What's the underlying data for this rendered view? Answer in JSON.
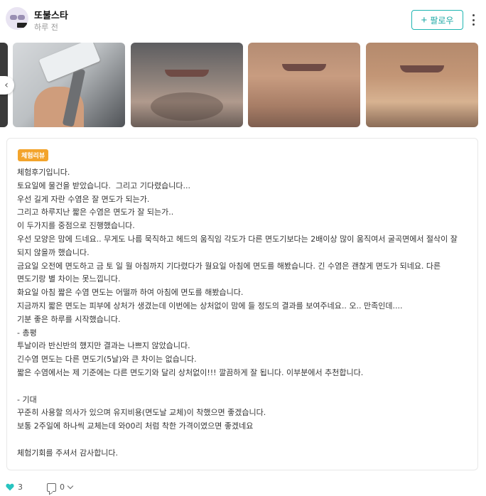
{
  "post": {
    "author": "또불스타",
    "time_ago": "하루 전",
    "follow_label": "팔로우"
  },
  "gallery": {
    "images": [
      {
        "name": "razor-in-hand"
      },
      {
        "name": "chin-before-shave"
      },
      {
        "name": "chin-shaved"
      },
      {
        "name": "chin-shaved-closeup"
      }
    ]
  },
  "review": {
    "badge": "체험리뷰",
    "lines": [
      "체험후기입니다.",
      "토요일에 물건을 받았습니다.  그리고 기다렸습니다...",
      "우선 길게 자란 수염은 잘 면도가 되는가.",
      "그리고 하루지난 짧은 수염은 면도가 잘 되는가..",
      "이 두가지를 중점으로 진행했습니다.",
      "우선 모양은 맘에 드네요.. 무게도 나름 묵직하고 헤드의 움직임 각도가 다른 면도기보다는 2배이상 많이 움직여서 굴곡면에서 절삭이 잘 되지 않을까 했습니다.",
      "금요일 오전에 면도하고 금 토 일 월 아침까지 기다렸다가 월요일 아침에 면도를 해봤습니다. 긴 수염은 괜찮게 면도가 되네요. 다른 면도기랑 별 차이는 못느낍니다.",
      "화요일 아침 짧은 수염 면도는 어떨까 하여 아침에 면도를 해봤습니다.",
      "지금까지 짧은 면도는 피부에 상처가 생겼는데 이번에는 상처없이 맘에 들 정도의 결과를 보여주네요.. 오.. 만족인데....",
      "기분 좋은 하루를 시작했습니다.",
      "- 총평",
      "투날이라 반신반의 했지만 결과는 나쁘지 않았습니다.",
      "긴수염 면도는 다른 면도기(5날)와 큰 차이는 없습니다.",
      "짧은 수염에서는 제 기준에는 다른 면도기와 달리 상처없이!!! 깔끔하게 잘 됩니다. 이부분에서 추천합니다.",
      "",
      "- 기대",
      "꾸준히 사용할 의사가 있으며 유지비용(면도날 교체)이 착했으면 좋겠습니다.",
      "보통 2주일에 하나씩 교체는데 와00리 처럼 착한 가격이였으면 좋겠네요",
      "",
      "체험기회를 주셔서 감사합니다."
    ]
  },
  "footer": {
    "like_count": "3",
    "comment_count": "0"
  },
  "colors": {
    "accent": "#1fb5b2",
    "badge": "#f3a42c",
    "heart": "#27c4c0"
  },
  "icons": [
    "plus-icon",
    "more-vertical-icon",
    "chevron-left-icon",
    "heart-icon",
    "comment-icon",
    "chevron-down-icon"
  ]
}
